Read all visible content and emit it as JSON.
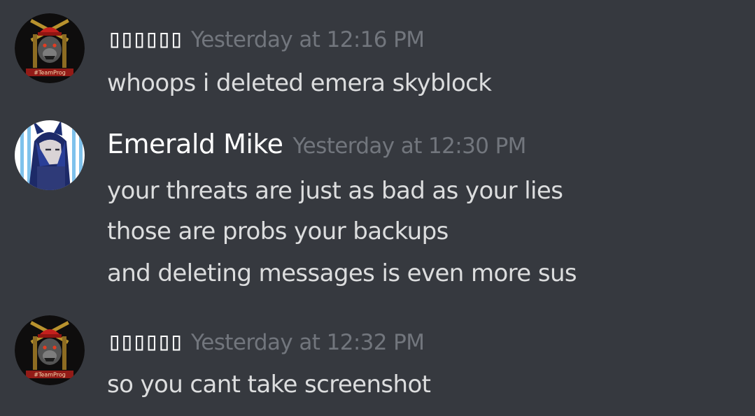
{
  "messages": [
    {
      "author": "▯▯▯▯▯▯",
      "timestamp": "Yesterday at 12:16 PM",
      "lines": [
        "whoops i deleted emera skyblock"
      ],
      "avatar_icon": "team-frog-gorilla-avatar",
      "avatar_text": "#TeamProg"
    },
    {
      "author": "Emerald Mike",
      "timestamp": "Yesterday at 12:30 PM",
      "lines": [
        "your threats are just as bad as your lies",
        "those are probs your backups",
        "and deleting messages is even more sus"
      ],
      "avatar_icon": "anime-character-avatar"
    },
    {
      "author": "▯▯▯▯▯▯",
      "timestamp": "Yesterday at 12:32 PM",
      "lines": [
        "so you cant take screenshot"
      ],
      "avatar_icon": "team-frog-gorilla-avatar",
      "avatar_text": "#TeamProg"
    }
  ],
  "colors": {
    "background": "#36393f",
    "username": "#ffffff",
    "timestamp": "#72767d",
    "message_text": "#dcddde"
  }
}
